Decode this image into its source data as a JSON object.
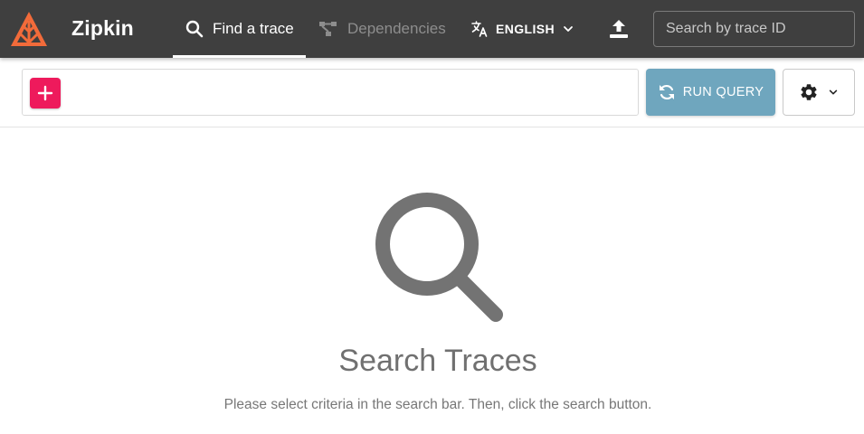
{
  "header": {
    "brand": "Zipkin",
    "nav": [
      {
        "label": "Find a trace",
        "icon": "search-icon",
        "active": true
      },
      {
        "label": "Dependencies",
        "icon": "dependencies-icon",
        "active": false
      }
    ],
    "language": {
      "label": "ENGLISH",
      "icon": "translate-icon"
    },
    "upload_icon": "upload-icon",
    "trace_search": {
      "placeholder": "Search by trace ID",
      "value": ""
    }
  },
  "query_bar": {
    "add_icon": "plus-icon",
    "run_label": "RUN QUERY",
    "run_icon": "refresh-icon",
    "settings_icon": "gear-icon"
  },
  "empty_state": {
    "title": "Search Traces",
    "hint": "Please select criteria in the search bar. Then, click the search button."
  },
  "colors": {
    "topbar": "#3f3f3f",
    "accent_pink": "#ee1a5c",
    "run_button": "#6fa6be",
    "logo_orange": "#f26b3a"
  }
}
